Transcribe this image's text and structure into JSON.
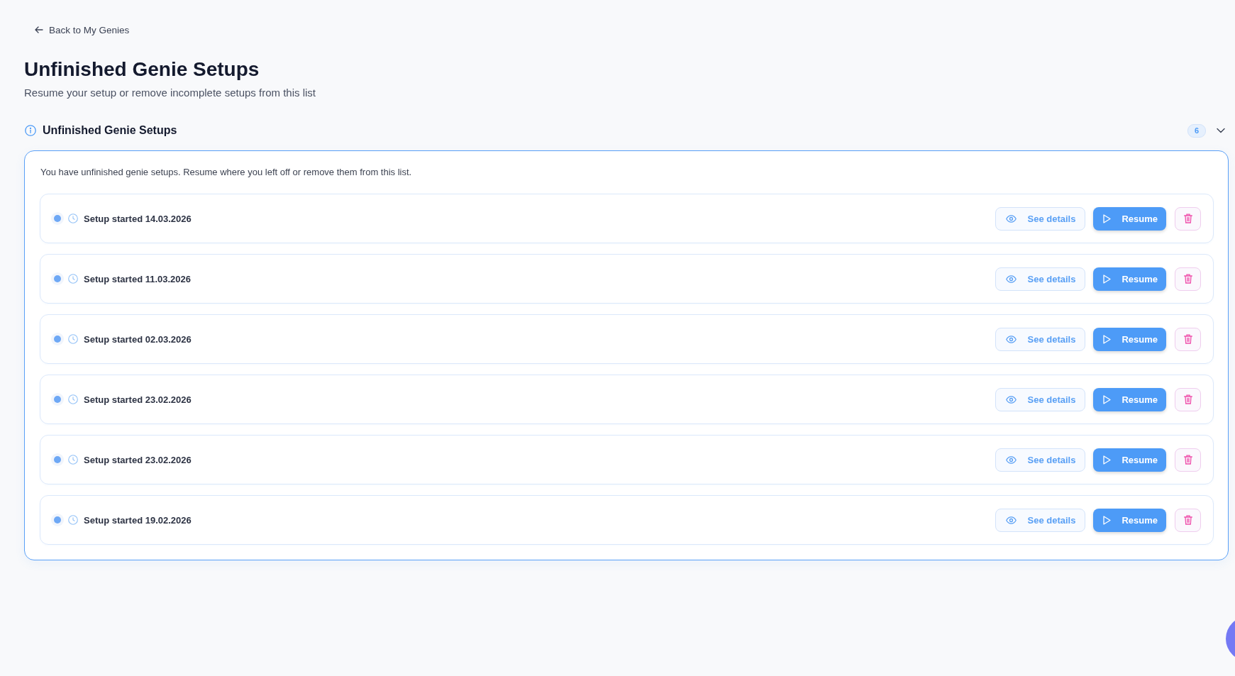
{
  "back_link": {
    "label": "Back to My Genies"
  },
  "header": {
    "title": "Unfinished Genie Setups",
    "subtitle": "Resume your setup or remove incomplete setups from this list"
  },
  "section": {
    "title": "Unfinished Genie Setups",
    "count": "6",
    "expanded": true,
    "description": "You have unfinished genie setups. Resume where you left off or remove them from this list.",
    "setups": [
      {
        "label": "Setup started 14.03.2026",
        "details_button": "See details",
        "resume_button": "Resume"
      },
      {
        "label": "Setup started 11.03.2026",
        "details_button": "See details",
        "resume_button": "Resume"
      },
      {
        "label": "Setup started 02.03.2026",
        "details_button": "See details",
        "resume_button": "Resume"
      },
      {
        "label": "Setup started 23.02.2026",
        "details_button": "See details",
        "resume_button": "Resume"
      },
      {
        "label": "Setup started 23.02.2026",
        "details_button": "See details",
        "resume_button": "Resume"
      },
      {
        "label": "Setup started 19.02.2026",
        "details_button": "See details",
        "resume_button": "Resume"
      }
    ]
  }
}
